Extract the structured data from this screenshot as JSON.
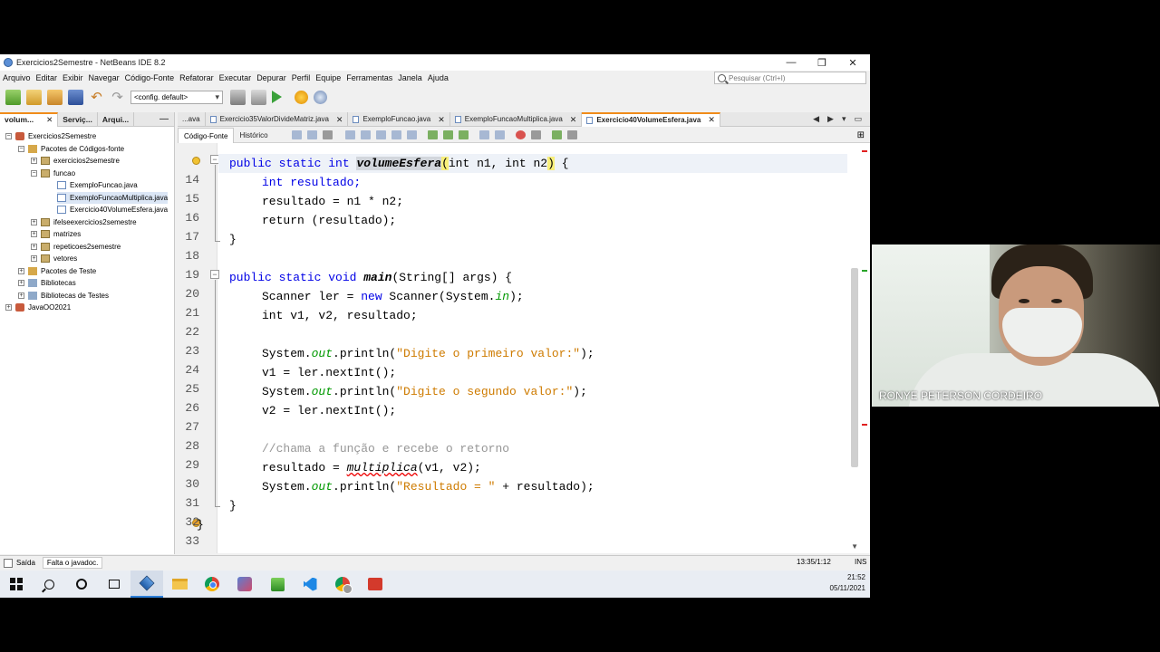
{
  "window": {
    "title": "Exercicios2Semestre - NetBeans IDE 8.2"
  },
  "menu": [
    "Arquivo",
    "Editar",
    "Exibir",
    "Navegar",
    "Código-Fonte",
    "Refatorar",
    "Executar",
    "Depurar",
    "Perfil",
    "Equipe",
    "Ferramentas",
    "Janela",
    "Ajuda"
  ],
  "search": {
    "placeholder": "Pesquisar (Ctrl+I)"
  },
  "toolbar": {
    "config": "<config. default>"
  },
  "left_panel": {
    "tabs": [
      "volum...",
      "Serviç...",
      "Arqui..."
    ],
    "tree": [
      "Exercicios2Semestre",
      "Pacotes de Códigos-fonte",
      "exercicios2semestre",
      "funcao",
      "ExemploFuncao.java",
      "ExemploFuncaoMultiplica.java",
      "Exercicio40VolumeEsfera.java",
      "ifelseexercicios2semestre",
      "matrizes",
      "repeticoes2semestre",
      "vetores",
      "Pacotes de Teste",
      "Bibliotecas",
      "Bibliotecas de Testes",
      "JavaOO2021"
    ]
  },
  "editor": {
    "tabs": [
      "...ava",
      "Exercicio35ValorDivideMatriz.java",
      "ExemploFuncao.java",
      "ExemploFuncaoMultiplica.java",
      "Exercicio40VolumeEsfera.java"
    ],
    "modes": [
      "Código-Fonte",
      "Histórico"
    ],
    "line_numbers": [
      "14",
      "15",
      "16",
      "17",
      "18",
      "19",
      "20",
      "21",
      "22",
      "23",
      "24",
      "25",
      "26",
      "27",
      "28",
      "29",
      "30",
      "31",
      "32",
      "33"
    ],
    "code": {
      "l13": {
        "kw": "public static int ",
        "fn": "volumeEsfera",
        "lp": "(",
        "args": "int n1, int n2",
        "rp": ")",
        "rest": " {"
      },
      "l14": "int resultado;",
      "l15": "resultado = n1 * n2;",
      "l16": "return (resultado);",
      "l17": "}",
      "l19_kw": "public static void ",
      "l19_fn": "main",
      "l19_rest": "(String[] args) {",
      "l20_a": "Scanner ler = ",
      "l20_kw": "new",
      "l20_b": " Scanner(System.",
      "l20_in": "in",
      "l20_c": ");",
      "l21": "int v1, v2, resultado;",
      "l23_a": "System.",
      "l23_out": "out",
      "l23_b": ".println(",
      "l23_str": "\"Digite o primeiro valor:\"",
      "l23_c": ");",
      "l24": "v1 = ler.nextInt();",
      "l25_a": "System.",
      "l25_out": "out",
      "l25_b": ".println(",
      "l25_str": "\"Digite o segundo valor:\"",
      "l25_c": ");",
      "l26": "v2 = ler.nextInt();",
      "l28": "//chama a função e recebe o retorno",
      "l29_a": "resultado = ",
      "l29_fn": "multiplica",
      "l29_b": "(v1, v2);",
      "l30_a": "System.",
      "l30_out": "out",
      "l30_b": ".println(",
      "l30_str": "\"Resultado = \"",
      "l30_c": " + resultado);",
      "l31": "}",
      "l32": "}"
    }
  },
  "status": {
    "output": "Saída",
    "message": "Falta o javadoc.",
    "position": "13:35/1:12",
    "mode": "INS"
  },
  "taskbar": {
    "time": "21:52",
    "date": "05/11/2021"
  },
  "webcam": {
    "name": "RONYE PETERSON CORDEIRO"
  },
  "colors": {
    "keyword": "#0000e6",
    "string": "#ce7b00",
    "static_field": "#009900",
    "comment": "#969696",
    "tab_accent": "#f08c1a"
  }
}
